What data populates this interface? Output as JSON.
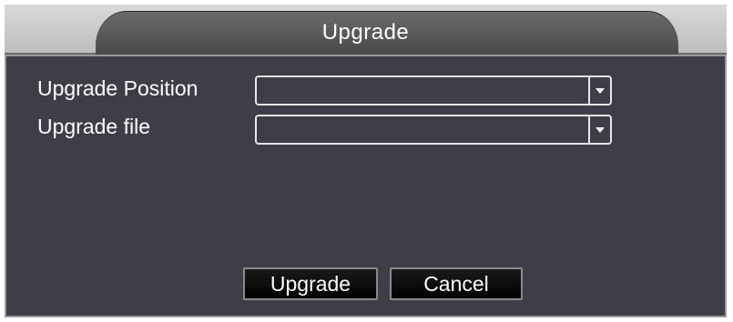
{
  "dialog": {
    "title": "Upgrade"
  },
  "form": {
    "upgrade_position": {
      "label": "Upgrade Position",
      "value": ""
    },
    "upgrade_file": {
      "label": "Upgrade file",
      "value": ""
    }
  },
  "buttons": {
    "upgrade_label": "Upgrade",
    "cancel_label": "Cancel"
  },
  "icons": {
    "dropdown": "chevron-down-icon"
  },
  "colors": {
    "panel_background": "#3d3e47",
    "titlebar_background": "#5a5a5a",
    "text": "#ffffff"
  }
}
